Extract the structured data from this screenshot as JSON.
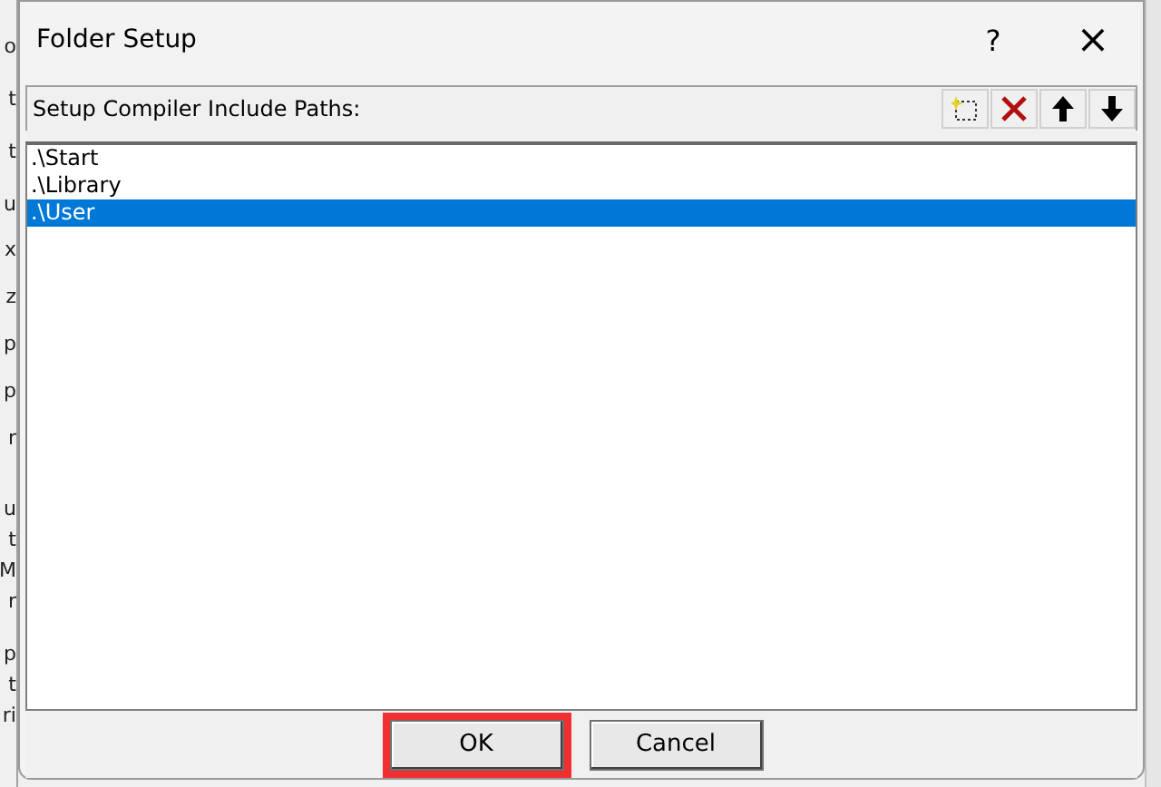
{
  "background_window": {
    "fragment_groups": [
      [
        "o",
        "t",
        "t",
        "u"
      ],
      [
        "x",
        "z",
        "p",
        "p",
        "r"
      ],
      [
        "u",
        "t",
        "M",
        "r"
      ],
      [
        "p",
        "t",
        "ri"
      ]
    ]
  },
  "dialog": {
    "title": "Folder Setup",
    "help_button": "?",
    "close_button": "×",
    "panel": {
      "label": "Setup Compiler Include Paths:",
      "toolbar": [
        {
          "kind": "new"
        },
        {
          "kind": "delete"
        },
        {
          "kind": "up"
        },
        {
          "kind": "down"
        }
      ]
    },
    "paths": [
      {
        "text": ".\\Start",
        "selected": false
      },
      {
        "text": ".\\Library",
        "selected": false
      },
      {
        "text": ".\\User",
        "selected": true
      }
    ],
    "buttons": [
      {
        "label": "OK",
        "highlighted": true
      },
      {
        "label": "Cancel",
        "highlighted": false
      }
    ]
  }
}
